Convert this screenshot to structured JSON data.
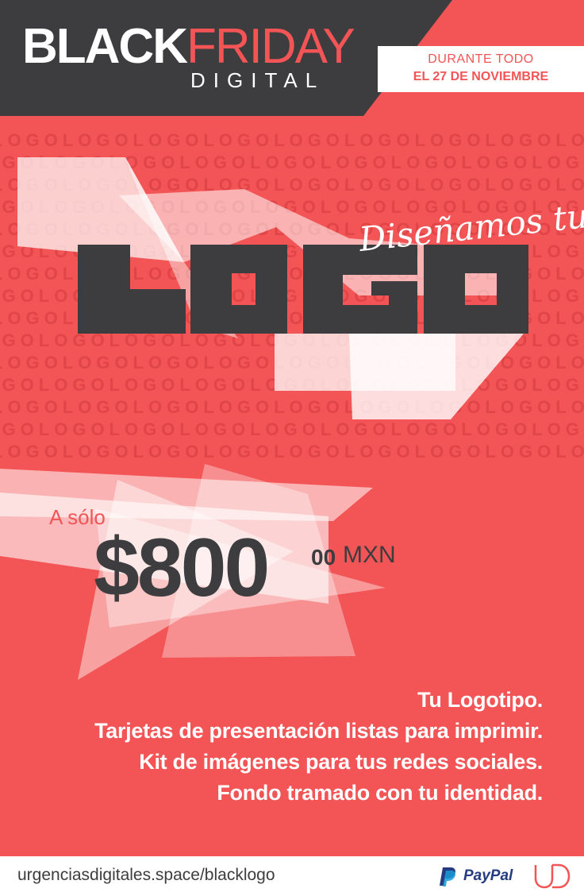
{
  "header": {
    "title_black": "BLACK",
    "title_friday": "FRIDAY",
    "subtitle": "DIGITAL",
    "date_line1": "DURANTE TODO",
    "date_line2": "EL 27 DE NOVIEMBRE"
  },
  "hero": {
    "script_text": "Diseñamos tu",
    "logo_word": "LOGO",
    "pattern_word": "LOGO"
  },
  "price": {
    "prefix": "A sólo",
    "amount": "$800",
    "cents": "00",
    "currency": "MXN"
  },
  "features": [
    "Tu Logotipo.",
    "Tarjetas de presentación listas para imprimir.",
    "Kit de imágenes para tus redes sociales.",
    "Fondo tramado con tu identidad."
  ],
  "footer": {
    "url": "urgenciasdigitales.space/blacklogo",
    "payment_name": "PayPal",
    "payment_icon": "paypal-icon",
    "brand_icon": "ud-logo-icon"
  },
  "colors": {
    "background": "#f35455",
    "dark": "#3d3d3f",
    "white": "#ffffff",
    "paypal_blue": "#253b80"
  }
}
